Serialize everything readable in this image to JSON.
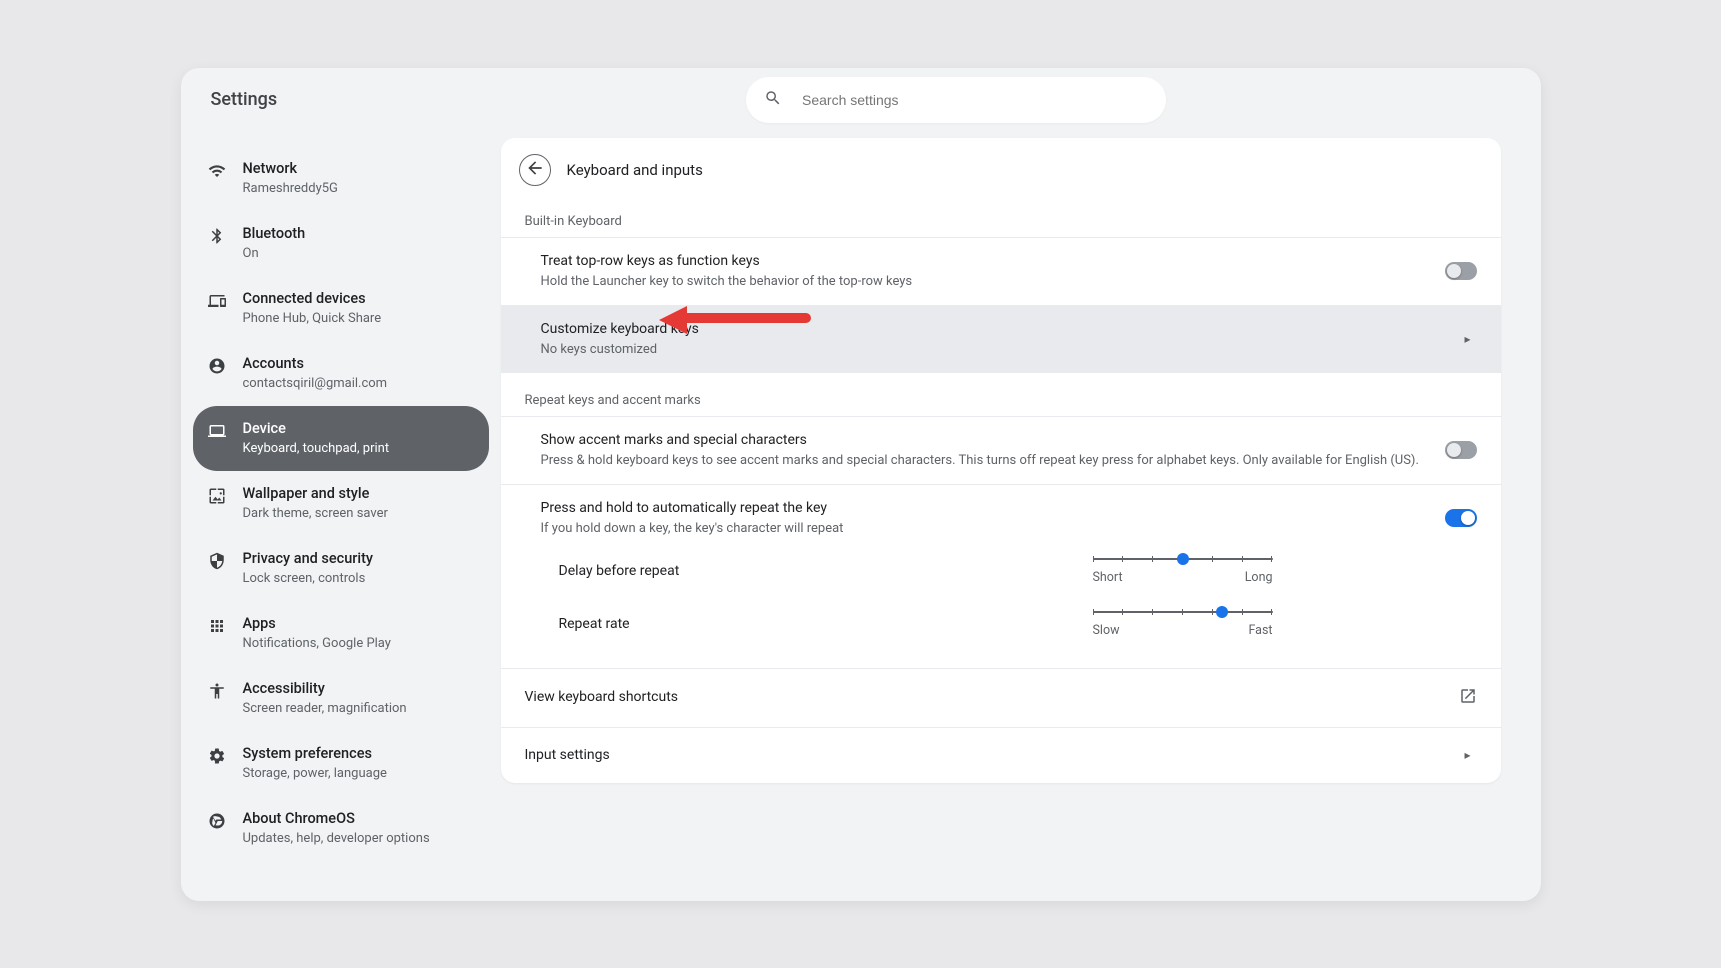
{
  "app_title": "Settings",
  "search": {
    "placeholder": "Search settings"
  },
  "sidebar": {
    "items": [
      {
        "label": "Network",
        "sub": "Rameshreddy5G"
      },
      {
        "label": "Bluetooth",
        "sub": "On"
      },
      {
        "label": "Connected devices",
        "sub": "Phone Hub, Quick Share"
      },
      {
        "label": "Accounts",
        "sub": "contactsqiril@gmail.com"
      },
      {
        "label": "Device",
        "sub": "Keyboard, touchpad, print"
      },
      {
        "label": "Wallpaper and style",
        "sub": "Dark theme, screen saver"
      },
      {
        "label": "Privacy and security",
        "sub": "Lock screen, controls"
      },
      {
        "label": "Apps",
        "sub": "Notifications, Google Play"
      },
      {
        "label": "Accessibility",
        "sub": "Screen reader, magnification"
      },
      {
        "label": "System preferences",
        "sub": "Storage, power, language"
      },
      {
        "label": "About ChromeOS",
        "sub": "Updates, help, developer options"
      }
    ]
  },
  "page": {
    "title": "Keyboard and inputs",
    "section1_title": "Built-in Keyboard",
    "row_topkeys": {
      "label": "Treat top-row keys as function keys",
      "sub": "Hold the Launcher key to switch the behavior of the top-row keys"
    },
    "row_customize": {
      "label": "Customize keyboard keys",
      "sub": "No keys customized"
    },
    "section2_title": "Repeat keys and accent marks",
    "row_accent": {
      "label": "Show accent marks and special characters",
      "sub": "Press & hold keyboard keys to see accent marks and special characters. This turns off repeat key press for alphabet keys. Only available for English (US)."
    },
    "row_repeat": {
      "label": "Press and hold to automatically repeat the key",
      "sub": "If you hold down a key, the key's character will repeat"
    },
    "slider_delay": {
      "label": "Delay before repeat",
      "left": "Short",
      "right": "Long"
    },
    "slider_rate": {
      "label": "Repeat rate",
      "left": "Slow",
      "right": "Fast"
    },
    "row_shortcuts": "View keyboard shortcuts",
    "row_input": "Input settings"
  }
}
